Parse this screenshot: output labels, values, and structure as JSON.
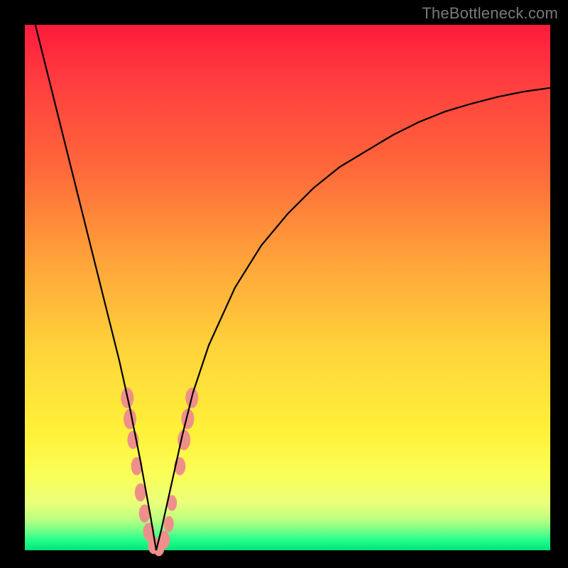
{
  "watermark": "TheBottleneck.com",
  "colors": {
    "frame": "#000000",
    "marker": "#ef8f8a",
    "curve": "#000000",
    "gradient_top": "#ff1a3c",
    "gradient_bottom": "#00e57a"
  },
  "chart_data": {
    "type": "line",
    "title": "",
    "xlabel": "",
    "ylabel": "",
    "xlim": [
      0,
      100
    ],
    "ylim": [
      0,
      100
    ],
    "minimum_x": 25,
    "series": [
      {
        "name": "bottleneck-curve",
        "x": [
          2,
          4,
          6,
          8,
          10,
          12,
          14,
          16,
          18,
          20,
          22,
          24,
          25,
          26,
          28,
          30,
          32,
          35,
          40,
          45,
          50,
          55,
          60,
          65,
          70,
          75,
          80,
          85,
          90,
          95,
          100
        ],
        "y": [
          100,
          92,
          84,
          76,
          68,
          60,
          52,
          44,
          36,
          27,
          17,
          6,
          0,
          4,
          13,
          22,
          30,
          39,
          50,
          58,
          64,
          69,
          73,
          76,
          79,
          81.5,
          83.5,
          85,
          86.3,
          87.3,
          88
        ]
      }
    ],
    "markers": {
      "name": "highlight-band-near-minimum",
      "points": [
        {
          "x": 19.5,
          "y": 29,
          "r": 9
        },
        {
          "x": 20.0,
          "y": 25,
          "r": 9
        },
        {
          "x": 20.6,
          "y": 21,
          "r": 8
        },
        {
          "x": 21.3,
          "y": 16,
          "r": 8
        },
        {
          "x": 22.0,
          "y": 11,
          "r": 8
        },
        {
          "x": 22.8,
          "y": 7,
          "r": 8
        },
        {
          "x": 23.6,
          "y": 3.5,
          "r": 8
        },
        {
          "x": 24.5,
          "y": 1,
          "r": 8
        },
        {
          "x": 25.5,
          "y": 0.6,
          "r": 8
        },
        {
          "x": 26.5,
          "y": 2,
          "r": 8
        },
        {
          "x": 27.4,
          "y": 5,
          "r": 7
        },
        {
          "x": 28.0,
          "y": 9,
          "r": 7
        },
        {
          "x": 29.5,
          "y": 16,
          "r": 8
        },
        {
          "x": 30.3,
          "y": 21,
          "r": 9
        },
        {
          "x": 31.0,
          "y": 25,
          "r": 9
        },
        {
          "x": 31.8,
          "y": 29,
          "r": 9
        }
      ]
    }
  }
}
